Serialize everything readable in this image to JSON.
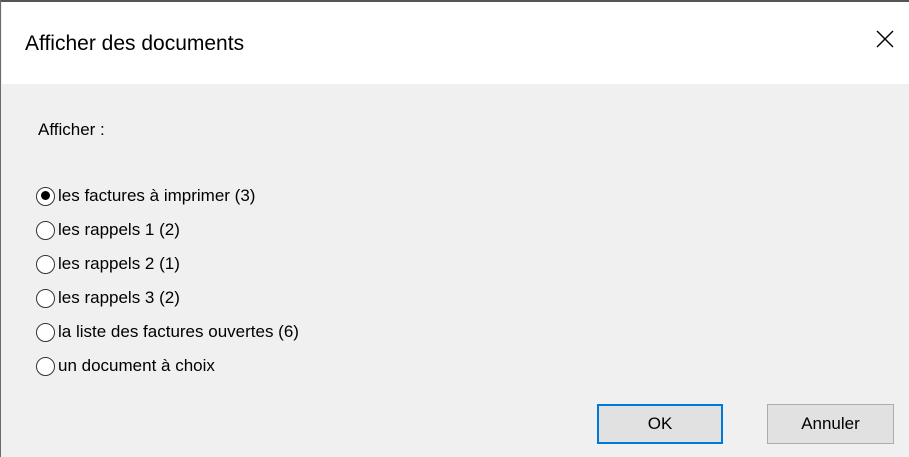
{
  "dialog": {
    "title": "Afficher des documents",
    "close_icon": "close-icon"
  },
  "content": {
    "prompt": "Afficher :",
    "options": [
      {
        "label": "les factures à imprimer (3)",
        "checked": true
      },
      {
        "label": "les rappels 1 (2)",
        "checked": false
      },
      {
        "label": "les rappels 2 (1)",
        "checked": false
      },
      {
        "label": "les rappels 3 (2)",
        "checked": false
      },
      {
        "label": "la liste des factures ouvertes (6)",
        "checked": false
      },
      {
        "label": "un document à choix",
        "checked": false
      }
    ]
  },
  "buttons": {
    "ok_label": "OK",
    "cancel_label": "Annuler"
  },
  "colors": {
    "accent": "#0078d7",
    "dialog_background": "#f0f0f0",
    "titlebar_background": "#ffffff",
    "button_background": "#e1e1e1"
  }
}
